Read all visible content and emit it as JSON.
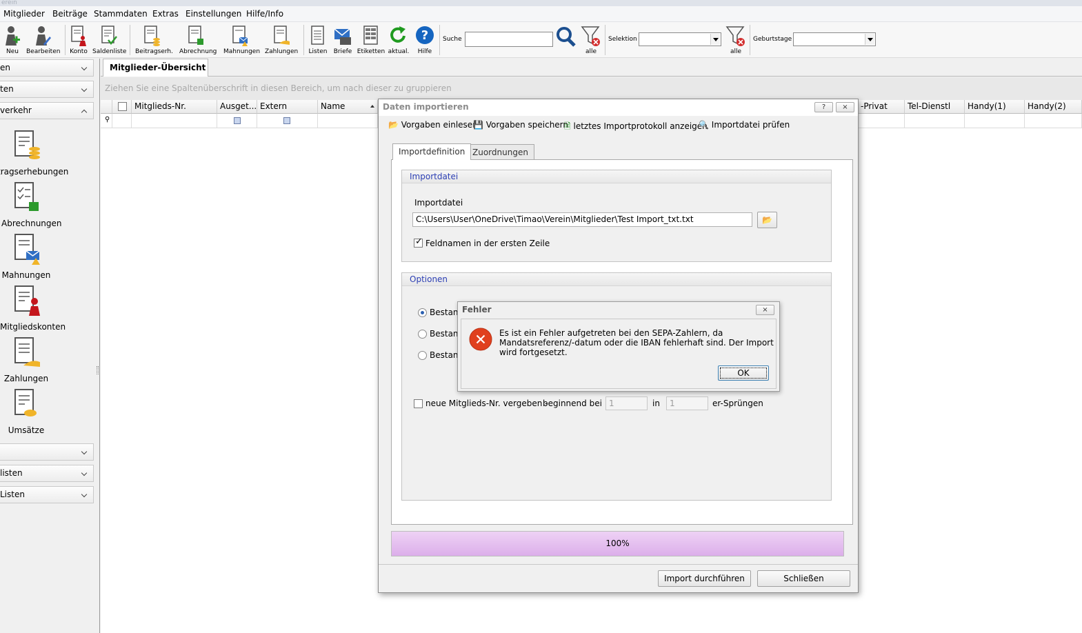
{
  "window": {
    "title_fragment": "erein"
  },
  "menu": [
    {
      "label": "Mitglieder"
    },
    {
      "label": "Beiträge"
    },
    {
      "label": "Stammdaten"
    },
    {
      "label": "Extras"
    },
    {
      "label": "Einstellungen"
    },
    {
      "label": "Hilfe/Info"
    }
  ],
  "toolbar": {
    "buttons": [
      {
        "label": "Neu",
        "icon": "add-person-icon"
      },
      {
        "label": "Bearbeiten",
        "icon": "edit-person-icon"
      },
      {
        "label": "Konto",
        "icon": "account-icon"
      },
      {
        "label": "Saldenliste",
        "icon": "balance-list-icon"
      },
      {
        "label": "Beitragserh.",
        "icon": "fee-collection-icon"
      },
      {
        "label": "Abrechnung",
        "icon": "settlement-icon"
      },
      {
        "label": "Mahnungen",
        "icon": "reminder-icon"
      },
      {
        "label": "Zahlungen",
        "icon": "payments-icon"
      },
      {
        "label": "Listen",
        "icon": "list-icon"
      },
      {
        "label": "Briefe",
        "icon": "letters-icon"
      },
      {
        "label": "Etiketten",
        "icon": "labels-icon"
      },
      {
        "label": "aktual.",
        "icon": "refresh-icon"
      },
      {
        "label": "Hilfe",
        "icon": "help-icon"
      }
    ],
    "search_label": "Suche",
    "search_value": "",
    "filter_all_label": "alle",
    "selection_label": "Selektion",
    "selection_value": "",
    "filter_all_label_2": "alle",
    "birthdays_label": "Geburtstage",
    "birthdays_value": ""
  },
  "sidebar": {
    "headers": [
      {
        "label": "en",
        "state": "collapsed"
      },
      {
        "label": "ten",
        "state": "collapsed"
      },
      {
        "label": "verkehr",
        "state": "expanded"
      },
      {
        "label": "",
        "state": "collapsed"
      },
      {
        "label": "listen",
        "state": "collapsed"
      },
      {
        "label": "Listen",
        "state": "collapsed"
      }
    ],
    "items": [
      {
        "label": "tragserhebungen",
        "icon": "fee-collection-icon"
      },
      {
        "label": "Abrechnungen",
        "icon": "settlement-icon"
      },
      {
        "label": "Mahnungen",
        "icon": "reminder-icon"
      },
      {
        "label": "Mitgliedskonten",
        "icon": "member-account-icon"
      },
      {
        "label": "Zahlungen",
        "icon": "payments-icon"
      },
      {
        "label": "Umsätze",
        "icon": "transactions-icon"
      }
    ]
  },
  "main": {
    "tab": "Mitglieder-Übersicht",
    "group_hint": "Ziehen Sie eine Spaltenüberschrift in diesen Bereich, um nach dieser zu gruppieren",
    "columns": [
      "Mitglieds-Nr.",
      "Ausget...",
      "Extern",
      "Name",
      "-Privat",
      "Tel-Dienstl",
      "Handy(1)",
      "Handy(2)"
    ]
  },
  "import_dialog": {
    "title": "Daten importieren",
    "help_btn": "?",
    "close_btn": "×",
    "toolbar": [
      "Vorgaben einlesen",
      "Vorgaben speichern",
      "letztes Importprotokoll anzeigen",
      "Importdatei prüfen"
    ],
    "tabs": [
      "Importdefinition",
      "Zuordnungen"
    ],
    "group_file": {
      "title": "Importdatei",
      "field_label": "Importdatei",
      "path": "C:\\Users\\User\\OneDrive\\Timao\\Verein\\Mitglieder\\Test Import_txt.txt",
      "header_row_label": "Feldnamen in der ersten Zeile",
      "header_row_checked": true
    },
    "group_options": {
      "title": "Optionen",
      "radios": [
        "Bestand",
        "Bestand",
        "Bestand"
      ],
      "selected_index": 0,
      "new_number_label": "neue Mitglieds-Nr. vergeben -",
      "beginning_label": "beginnend bei",
      "start_value": "1",
      "in_label": "in",
      "step_value": "1",
      "steps_label": "er-Sprüngen",
      "new_number_checked": false
    },
    "progress": {
      "text": "100%",
      "value": 1.0
    },
    "buttons": {
      "run": "Import durchführen",
      "close": "Schließen"
    }
  },
  "error_dialog": {
    "title": "Fehler",
    "close_btn": "×",
    "message": "Es ist ein Fehler aufgetreten bei den SEPA-Zahlern, da Mandatsreferenz/-datum oder die IBAN fehlerhaft sind. Der Import wird fortgesetzt.",
    "ok": "OK"
  },
  "colors": {
    "accent_blue": "#2c3fb4",
    "progress_fill": "#e2b8ee",
    "error_red": "#e0401e"
  }
}
